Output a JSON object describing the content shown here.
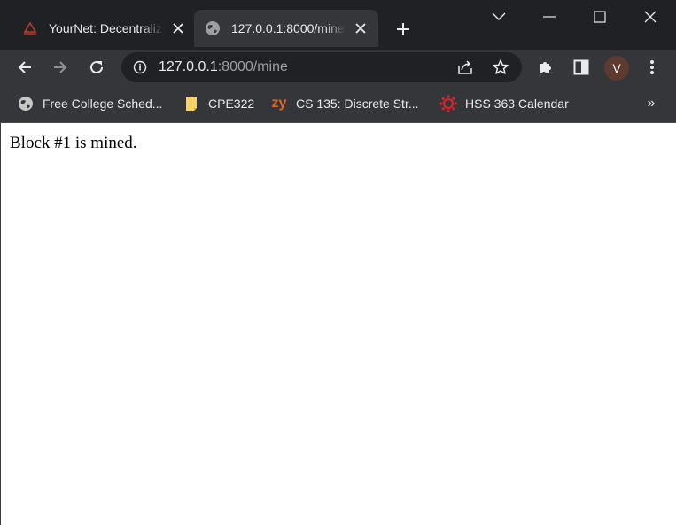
{
  "tabs": [
    {
      "title": "YourNet: Decentralized",
      "active": false
    },
    {
      "title": "127.0.0.1:8000/mine",
      "active": true
    }
  ],
  "omnibox": {
    "url_host": "127.0.0.1",
    "url_rest": ":8000/mine"
  },
  "profile": {
    "initial": "V",
    "color": "#5d3b2e"
  },
  "bookmarks": [
    {
      "label": "Free College Sched...",
      "icon": "globe-icon"
    },
    {
      "label": "CPE322",
      "icon": "note-icon"
    },
    {
      "label": "CS 135: Discrete Str...",
      "icon": "zybooks-icon",
      "icon_text": "zy"
    },
    {
      "label": "HSS 363 Calendar",
      "icon": "canvas-icon"
    }
  ],
  "bookmarks_more": "»",
  "page": {
    "body_text": "Block #1 is mined."
  },
  "colors": {
    "tabstrip": "#202124",
    "toolbar": "#35363a",
    "text": "#e8eaed",
    "muted": "#9aa0a6",
    "zybooks": "#e8632b",
    "canvas": "#d8232a"
  }
}
